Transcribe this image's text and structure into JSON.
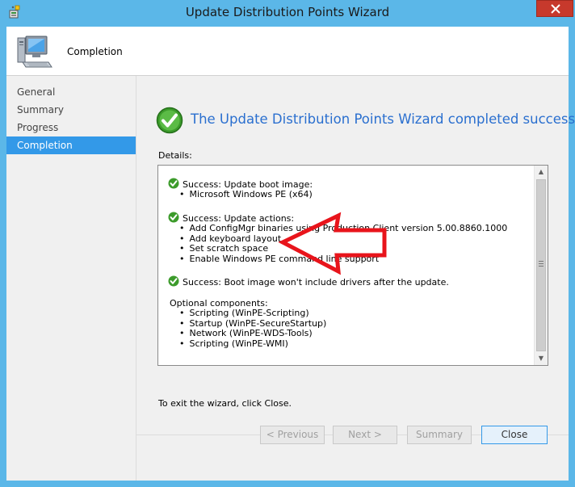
{
  "window": {
    "title": "Update Distribution Points Wizard",
    "titlebar_color": "#5bb7e8",
    "close_button_color": "#c7392c"
  },
  "header": {
    "title": "Completion",
    "icon": "computer-icon"
  },
  "nav": {
    "items": [
      {
        "label": "General",
        "active": false
      },
      {
        "label": "Summary",
        "active": false
      },
      {
        "label": "Progress",
        "active": false
      },
      {
        "label": "Completion",
        "active": true
      }
    ],
    "active_color": "#3399e8"
  },
  "main": {
    "headline": "The Update Distribution Points Wizard completed successfully",
    "headline_color": "#2a6fcf",
    "details_label": "Details:",
    "details": {
      "boot_image_success": "Success: Update boot image:",
      "boot_image_items": [
        "Microsoft Windows PE (x64)"
      ],
      "actions_success": "Success: Update actions:",
      "action_items": [
        "Add ConfigMgr binaries using Production Client version 5.00.8860.1000",
        "Add keyboard layout",
        "Set scratch space",
        "Enable Windows PE command line support"
      ],
      "drivers_success": "Success: Boot image won't include drivers after the update.",
      "optional_heading": "Optional components:",
      "optional_items": [
        "Scripting (WinPE-Scripting)",
        "Startup (WinPE-SecureStartup)",
        "Network (WinPE-WDS-Tools)",
        "Scripting (WinPE-WMI)"
      ]
    },
    "exit_text": "To exit the wizard, click Close."
  },
  "annotation": {
    "type": "red-arrow",
    "points_to": "Add keyboard layout",
    "color": "#e8141b"
  },
  "buttons": {
    "previous": "< Previous",
    "next": "Next >",
    "summary": "Summary",
    "close": "Close"
  }
}
